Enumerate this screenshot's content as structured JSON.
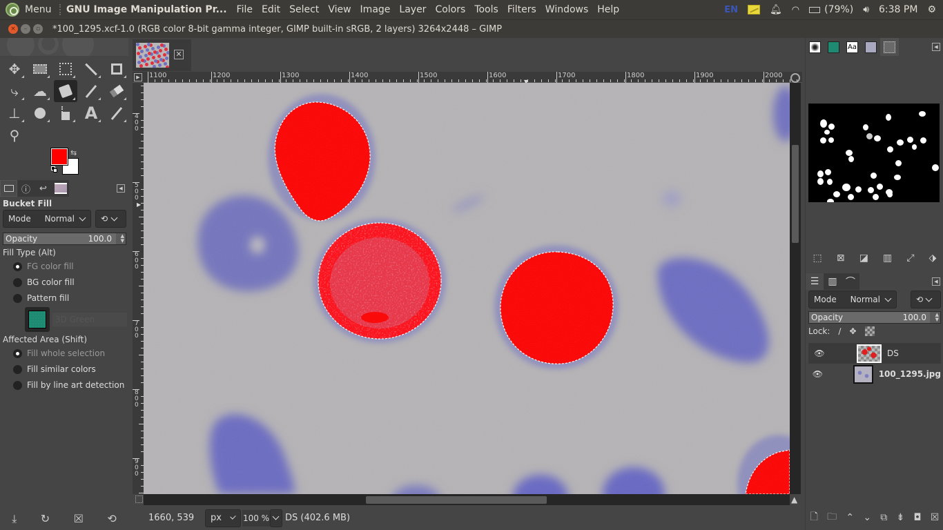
{
  "system_bar": {
    "menu_label": "Menu",
    "app_name": "GNU Image Manipulation Pr...",
    "menu_items": [
      "File",
      "Edit",
      "Select",
      "View",
      "Image",
      "Layer",
      "Colors",
      "Tools",
      "Filters",
      "Windows",
      "Help"
    ],
    "keyboard_layout": "EN",
    "battery": "(79%)",
    "time": "6:38 PM"
  },
  "window": {
    "title": "*100_1295.xcf-1.0 (RGB color 8-bit gamma integer, GIMP built-in sRGB, 2 layers) 3264x2448 – GIMP"
  },
  "toolbox": {
    "tools": [
      {
        "name": "move-tool",
        "glyph": "✥"
      },
      {
        "name": "rect-select-tool",
        "glyph": "▭"
      },
      {
        "name": "foreground-select-tool",
        "glyph": "⧠"
      },
      {
        "name": "fuzzy-select-tool",
        "glyph": "⚟"
      },
      {
        "name": "crop-tool",
        "glyph": "⌗"
      },
      {
        "name": "unified-transform-tool",
        "glyph": "⤷"
      },
      {
        "name": "warp-transform-tool",
        "glyph": "☁"
      },
      {
        "name": "bucket-fill-tool",
        "glyph": "◩"
      },
      {
        "name": "paintbrush-tool",
        "glyph": "⁄"
      },
      {
        "name": "eraser-tool",
        "glyph": "⌫"
      },
      {
        "name": "clone-tool",
        "glyph": "⊥"
      },
      {
        "name": "smudge-tool",
        "glyph": "☛"
      },
      {
        "name": "paths-tool",
        "glyph": "⌇"
      },
      {
        "name": "text-tool",
        "glyph": "A"
      },
      {
        "name": "color-picker-tool",
        "glyph": "⁄"
      },
      {
        "name": "zoom-tool",
        "glyph": "⚲"
      }
    ],
    "active_tool": "bucket-fill-tool",
    "fg_color": "#ff0000",
    "bg_color": "#ffffff"
  },
  "tool_options": {
    "title": "Bucket Fill",
    "mode_label": "Mode",
    "mode_value": "Normal",
    "opacity_label": "Opacity",
    "opacity_value": "100.0",
    "fill_type_label": "Fill Type  (Alt)",
    "fill_types": [
      {
        "label": "FG color fill",
        "selected": true
      },
      {
        "label": "BG color fill",
        "selected": false
      },
      {
        "label": "Pattern fill",
        "selected": false
      }
    ],
    "pattern_name": "3D Green",
    "affected_area_label": "Affected Area  (Shift)",
    "affected_areas": [
      {
        "label": "Fill whole selection",
        "selected": true
      },
      {
        "label": "Fill similar colors",
        "selected": false
      },
      {
        "label": "Fill by line art detection",
        "selected": false
      }
    ]
  },
  "canvas": {
    "hruler_labels": [
      "1100",
      "1200",
      "1300",
      "1400",
      "1500",
      "1600",
      "1700",
      "1800",
      "1900",
      "2000"
    ],
    "vruler_labels": [
      "400",
      "500",
      "600",
      "700",
      "800",
      "900"
    ],
    "fill_color": "#ff0000",
    "background_color": "#b4b2b4",
    "cell_color": "#6f6fbf"
  },
  "statusbar": {
    "coords": "1660, 539",
    "unit": "px",
    "zoom": "100 %",
    "message": "DS (402.6 MB)"
  },
  "layers_panel": {
    "mode_label": "Mode",
    "mode_value": "Normal",
    "opacity_label": "Opacity",
    "opacity_value": "100.0",
    "lock_label": "Lock:",
    "layers": [
      {
        "name": "DS",
        "visible": true,
        "selected": true
      },
      {
        "name": "100_1295.jpg",
        "visible": true,
        "selected": false
      }
    ]
  }
}
